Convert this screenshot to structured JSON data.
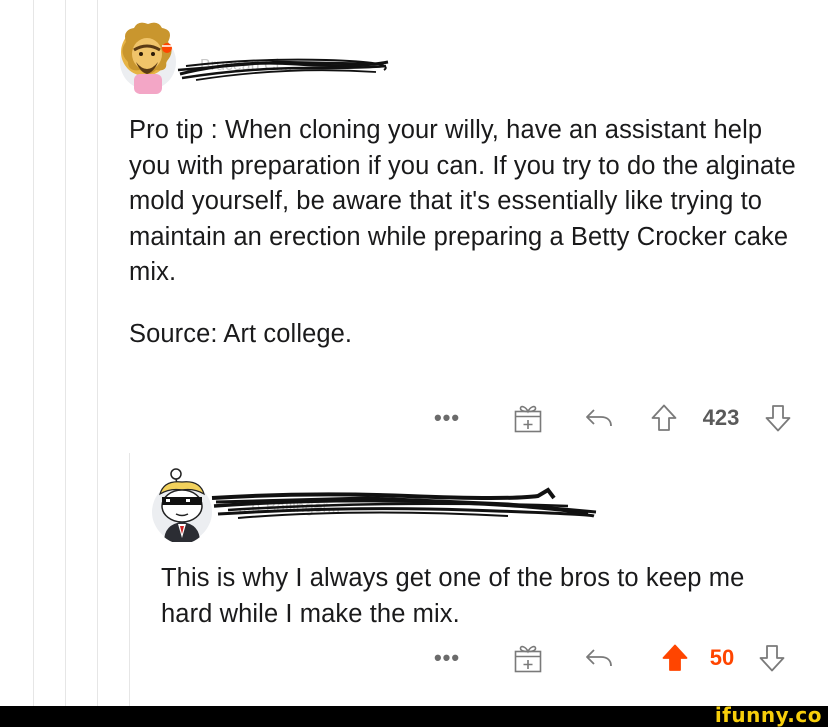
{
  "comments": [
    {
      "username": "Bruceau Cl...",
      "paragraphs": [
        "Pro tip : When cloning your willy, have an assistant help you with preparation if you can. If you try to do the alginate mold yourself, be aware that it's essentially like trying to maintain an erection while preparing a Betty Crocker cake mix.",
        "Source: Art college."
      ],
      "more_label": "•••",
      "score": "423",
      "upvoted": false
    },
    {
      "username": "...e-Ballinger...",
      "paragraphs": [
        "This is why I always get one of the bros to keep me hard while I make the mix."
      ],
      "more_label": "•••",
      "score": "50",
      "upvoted": true
    }
  ],
  "colors": {
    "upvote_active": "#ff4500",
    "icon_gray": "#7a7a7a",
    "thread_line": "#e6e6e6",
    "watermark": "#f7ce0b"
  },
  "icons": [
    "more-icon",
    "award-gift-icon",
    "reply-icon",
    "upvote-icon",
    "downvote-icon"
  ],
  "watermark": "ifunny.co"
}
